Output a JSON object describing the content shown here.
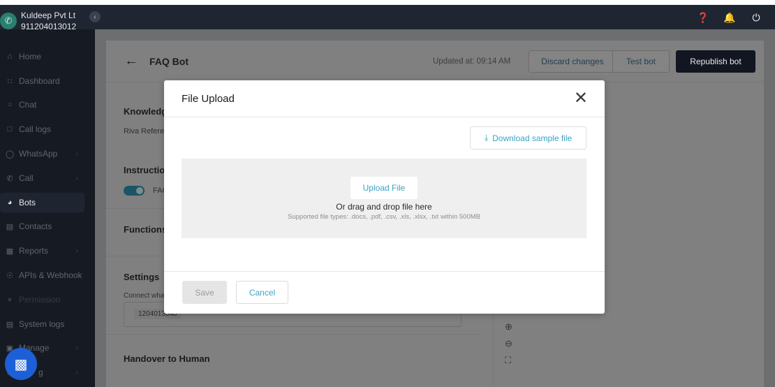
{
  "account": {
    "name": "Kuldeep Pvt Lt",
    "number": "911204013012"
  },
  "topbar_icons": [
    "help-icon",
    "bell-icon",
    "power-icon"
  ],
  "sidebar": {
    "items": [
      {
        "label": "Home",
        "icon": "home-icon"
      },
      {
        "label": "Dashboard",
        "icon": "grid-icon"
      },
      {
        "label": "Chat",
        "icon": "chat-icon"
      },
      {
        "label": "Call logs",
        "icon": "call-log-icon"
      },
      {
        "label": "WhatsApp",
        "icon": "whatsapp-icon"
      },
      {
        "label": "Call",
        "icon": "phone-icon"
      },
      {
        "label": "Bots",
        "icon": "bot-icon"
      },
      {
        "label": "Contacts",
        "icon": "contacts-icon"
      },
      {
        "label": "Reports",
        "icon": "reports-icon"
      },
      {
        "label": "APIs & Webhook",
        "icon": "api-icon"
      },
      {
        "label": "Permission",
        "icon": "permission-icon"
      },
      {
        "label": "System logs",
        "icon": "system-logs-icon"
      },
      {
        "label": "Manage",
        "icon": "manage-icon"
      },
      {
        "label": "g",
        "icon": "settings-icon"
      }
    ],
    "active": "Bots"
  },
  "header": {
    "title": "FAQ Bot",
    "updated": "Updated at: 09:14 AM",
    "discard_label": "Discard changes",
    "test_label": "Test bot",
    "republish_label": "Republish bot"
  },
  "background": {
    "knowledge_label": "Knowledg",
    "knowledge_sub": "Riva Refere",
    "instruction_label": "Instructio",
    "toggle_label": "FAC",
    "functions_label": "Functions",
    "settings_label": "Settings",
    "connect_label": "Connect wha",
    "chip_value": "1204013048",
    "handover_label": "Handover to Human"
  },
  "modal": {
    "title": "File Upload",
    "download_label": "Download sample file",
    "upload_label": "Upload File",
    "drag_text": "Or drag and drop file here",
    "types_text": "Supported file types: .docs, .pdf, .csv, .xls, .xlsx, .txt within 500MB",
    "save_label": "Save",
    "cancel_label": "Cancel"
  },
  "colors": {
    "accent": "#3ba2c4",
    "sidebar_bg": "#161b23",
    "primary_dark": "#111621"
  }
}
